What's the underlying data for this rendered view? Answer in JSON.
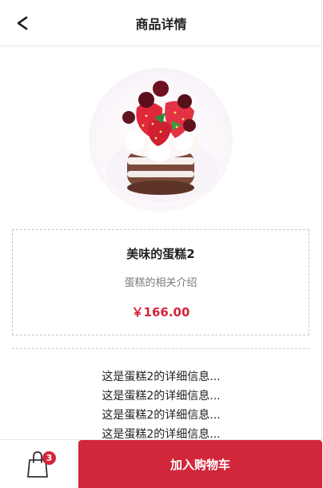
{
  "header": {
    "title": "商品详情",
    "back_icon": "chevron-left-icon"
  },
  "product": {
    "image": "cake-image",
    "name": "美味的蛋糕2",
    "description": "蛋糕的相关介绍",
    "price": "￥166.00"
  },
  "details": {
    "lines": [
      "这是蛋糕2的详细信息...",
      "这是蛋糕2的详细信息...",
      "这是蛋糕2的详细信息...",
      "这是蛋糕2的详细信息..."
    ]
  },
  "footer": {
    "cart_icon": "shopping-bag-icon",
    "cart_count": "3",
    "add_to_cart_label": "加入购物车"
  },
  "colors": {
    "accent": "#d2263a",
    "border": "#e5e5e5",
    "text": "#222222",
    "muted": "#7a7a7a"
  }
}
